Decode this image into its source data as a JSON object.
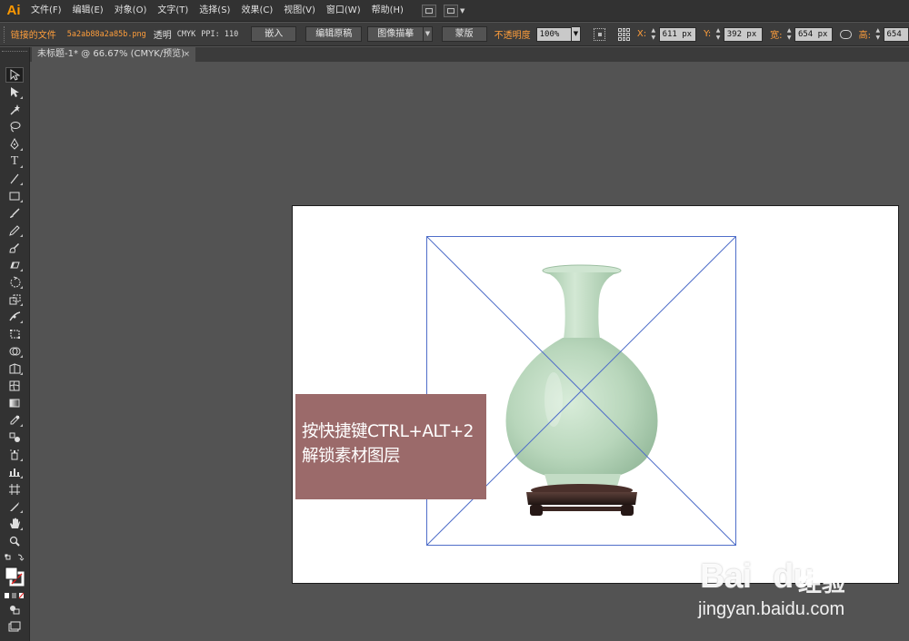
{
  "app": {
    "logo": "Ai"
  },
  "menu": {
    "items": [
      "文件(F)",
      "编辑(E)",
      "对象(O)",
      "文字(T)",
      "选择(S)",
      "效果(C)",
      "视图(V)",
      "窗口(W)",
      "帮助(H)"
    ]
  },
  "control_bar": {
    "linked_file_label": "链接的文件",
    "filename": "5a2ab88a2a85b.png",
    "transparency": "透明",
    "color_mode": "CMYK",
    "ppi": "PPI: 110",
    "embed_label": "嵌入",
    "edit_original_label": "编辑原稿",
    "image_trace_label": "图像描摹",
    "mask_label": "蒙版",
    "opacity_label": "不透明度",
    "opacity_value": "100%",
    "x_label": "X:",
    "x_value": "611 px",
    "y_label": "Y:",
    "y_value": "392 px",
    "w_label": "宽:",
    "w_value": "654 px",
    "h_label": "高:",
    "h_value": "654"
  },
  "document_tab": {
    "title": "未标题-1* @ 66.67% (CMYK/预览)",
    "close": "×"
  },
  "canvas": {
    "note_lines": [
      "按快捷键CTRL+ALT+2",
      "解锁素材图层"
    ],
    "note_color": "#9b6a6a"
  },
  "watermark": {
    "logo": "Bai",
    "logo_suffix": "du",
    "brand": "经验",
    "url": "jingyan.baidu.com"
  },
  "colors": {
    "accent": "#ff9a00",
    "selection": "#4f6ec9",
    "vase": "#bcd8bf"
  }
}
